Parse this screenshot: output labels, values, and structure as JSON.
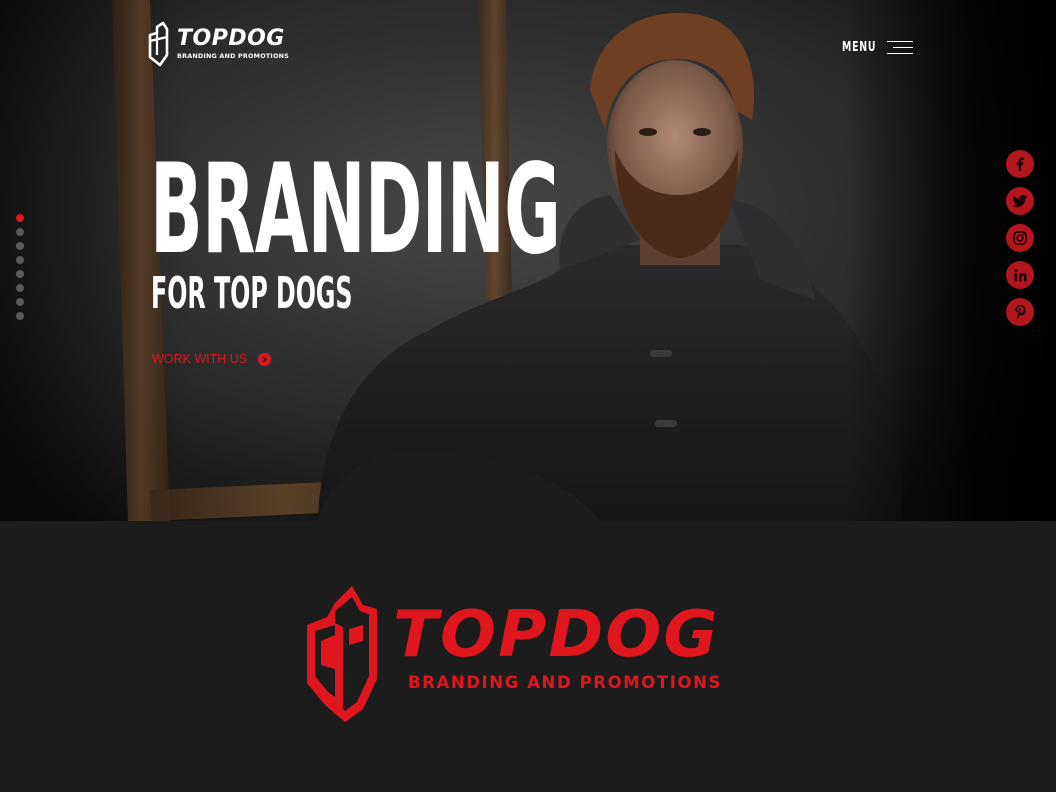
{
  "brand": {
    "name": "TOPDOG",
    "tagline": "BRANDING AND PROMOTIONS",
    "accent_color": "#e0161e"
  },
  "nav": {
    "menu_label": "MENU",
    "menu_icon": "hamburger-icon"
  },
  "hero": {
    "headline": "BRANDING",
    "subheadline": "FOR TOP DOGS",
    "cta_label": "WORK WITH US",
    "cta_icon": "chevron-circle-right-icon",
    "slides_total": 8,
    "active_slide": 1
  },
  "social": [
    {
      "name": "facebook-icon",
      "glyph": "f"
    },
    {
      "name": "twitter-icon",
      "glyph": "t"
    },
    {
      "name": "instagram-icon",
      "glyph": "◎"
    },
    {
      "name": "linkedin-icon",
      "glyph": "in"
    },
    {
      "name": "pinterest-icon",
      "glyph": "p"
    }
  ],
  "footer_logo": {
    "name": "TOPDOG",
    "tagline": "BRANDING AND PROMOTIONS"
  }
}
